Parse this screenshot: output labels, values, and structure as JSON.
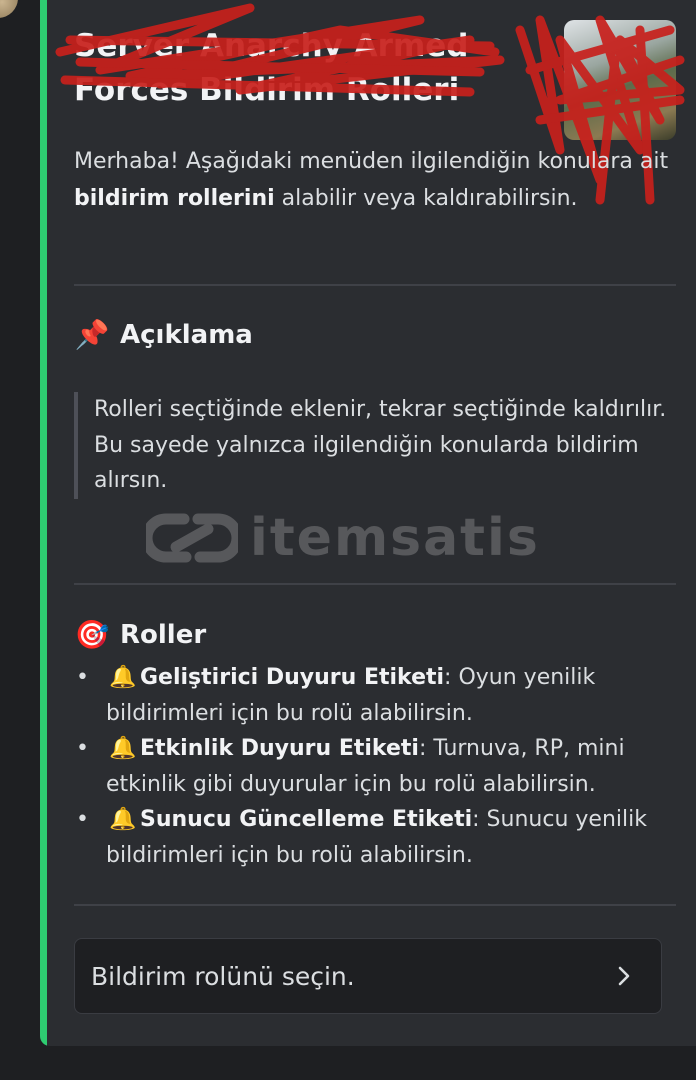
{
  "embed": {
    "accent_color": "#2ecc71",
    "title_line2": "Forces Bildirim Rolleri",
    "intro": {
      "part1": "Merhaba! Aşağıdaki menüden ilgilendiğin konulara ait ",
      "bold": "bildirim rollerini",
      "part2": " alabilir veya kaldırabilirsin."
    },
    "description_section": {
      "icon": "pushpin-icon",
      "heading": "Açıklama",
      "quote_line1": "Rolleri seçtiğinde eklenir, tekrar seçtiğinde kaldırılır.",
      "quote_line2": "Bu sayede yalnızca ilgilendiğin konularda bildirim alırsın."
    },
    "roles_section": {
      "icon": "target-icon",
      "heading": "Roller",
      "items": [
        {
          "icon": "bell-icon",
          "name": "Geliştirici Duyuru Etiketi",
          "desc": ": Oyun yenilik bildirimleri için bu rolü alabilirsin."
        },
        {
          "icon": "bell-icon",
          "name": "Etkinlik Duyuru Etiketi",
          "desc": ": Turnuva, RP, mini etkinlik gibi duyurular için bu rolü alabilirsin."
        },
        {
          "icon": "bell-icon",
          "name": "Sunucu Güncelleme Etiketi",
          "desc": ": Sunucu yenilik bildirimleri için bu rolü alabilirsin."
        }
      ]
    },
    "select_menu": {
      "placeholder": "Bildirim rolünü seçin."
    }
  },
  "watermark": {
    "text": "itemsatis"
  }
}
